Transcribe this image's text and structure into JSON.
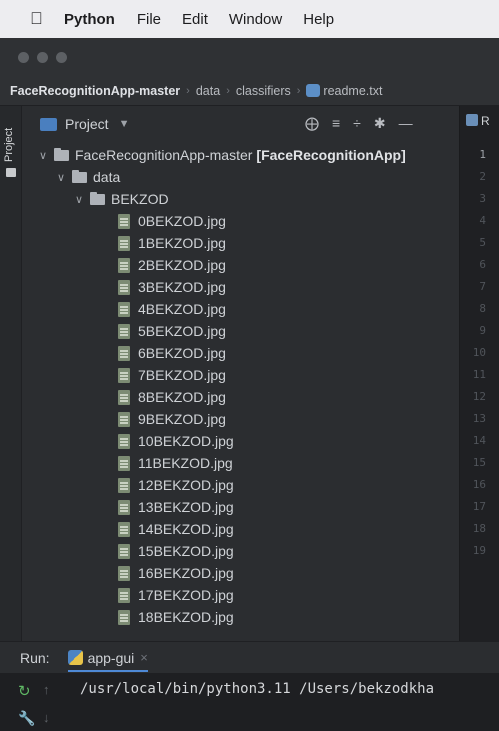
{
  "menubar": {
    "items": [
      "Python",
      "File",
      "Edit",
      "Window",
      "Help"
    ]
  },
  "breadcrumb": {
    "project": "FaceRecognitionApp-master",
    "folder1": "data",
    "folder2": "classifiers",
    "file": "readme.txt"
  },
  "toolwindow": {
    "side_label": "Project",
    "title": "Project"
  },
  "tree": {
    "root_name": "FaceRecognitionApp-master",
    "root_module": "[FaceRecognitionApp]",
    "data_folder": "data",
    "bekzod_folder": "BEKZOD",
    "files": [
      "0BEKZOD.jpg",
      "1BEKZOD.jpg",
      "2BEKZOD.jpg",
      "3BEKZOD.jpg",
      "4BEKZOD.jpg",
      "5BEKZOD.jpg",
      "6BEKZOD.jpg",
      "7BEKZOD.jpg",
      "8BEKZOD.jpg",
      "9BEKZOD.jpg",
      "10BEKZOD.jpg",
      "11BEKZOD.jpg",
      "12BEKZOD.jpg",
      "13BEKZOD.jpg",
      "14BEKZOD.jpg",
      "15BEKZOD.jpg",
      "16BEKZOD.jpg",
      "17BEKZOD.jpg",
      "18BEKZOD.jpg"
    ]
  },
  "editor": {
    "tab_label": "R",
    "line_numbers": [
      "1",
      "2",
      "3",
      "4",
      "5",
      "6",
      "7",
      "8",
      "9",
      "10",
      "11",
      "12",
      "13",
      "14",
      "15",
      "16",
      "17",
      "18",
      "19"
    ]
  },
  "run": {
    "label": "Run:",
    "config": "app-gui",
    "command": "/usr/local/bin/python3.11 /Users/bekzodkha"
  },
  "colors": {
    "background": "#2b2d30",
    "accent": "#4e89d6",
    "run_green": "#5fb865"
  }
}
